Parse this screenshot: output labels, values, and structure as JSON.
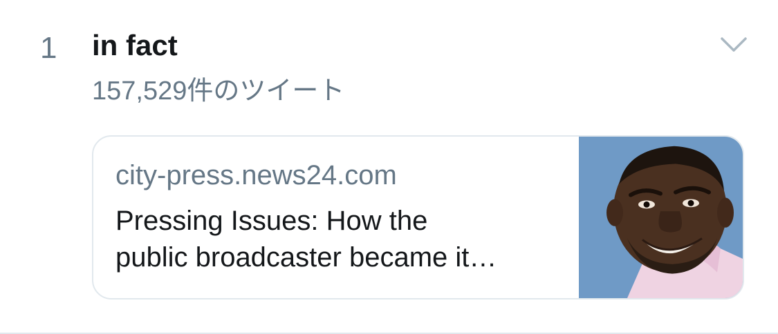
{
  "trend": {
    "rank": "1",
    "name": "in fact",
    "tweet_count": "157,529件のツイート"
  },
  "card": {
    "domain": "city-press.news24.com",
    "title_line1": "Pressing Issues: How the",
    "title_line2": "public broadcaster became it…",
    "thumbnail_icon": "person-photo"
  },
  "colors": {
    "primary_text": "#14171a",
    "secondary_text": "#657786",
    "border": "#e1e8ed",
    "thumb_background": "#6f9ac6"
  }
}
